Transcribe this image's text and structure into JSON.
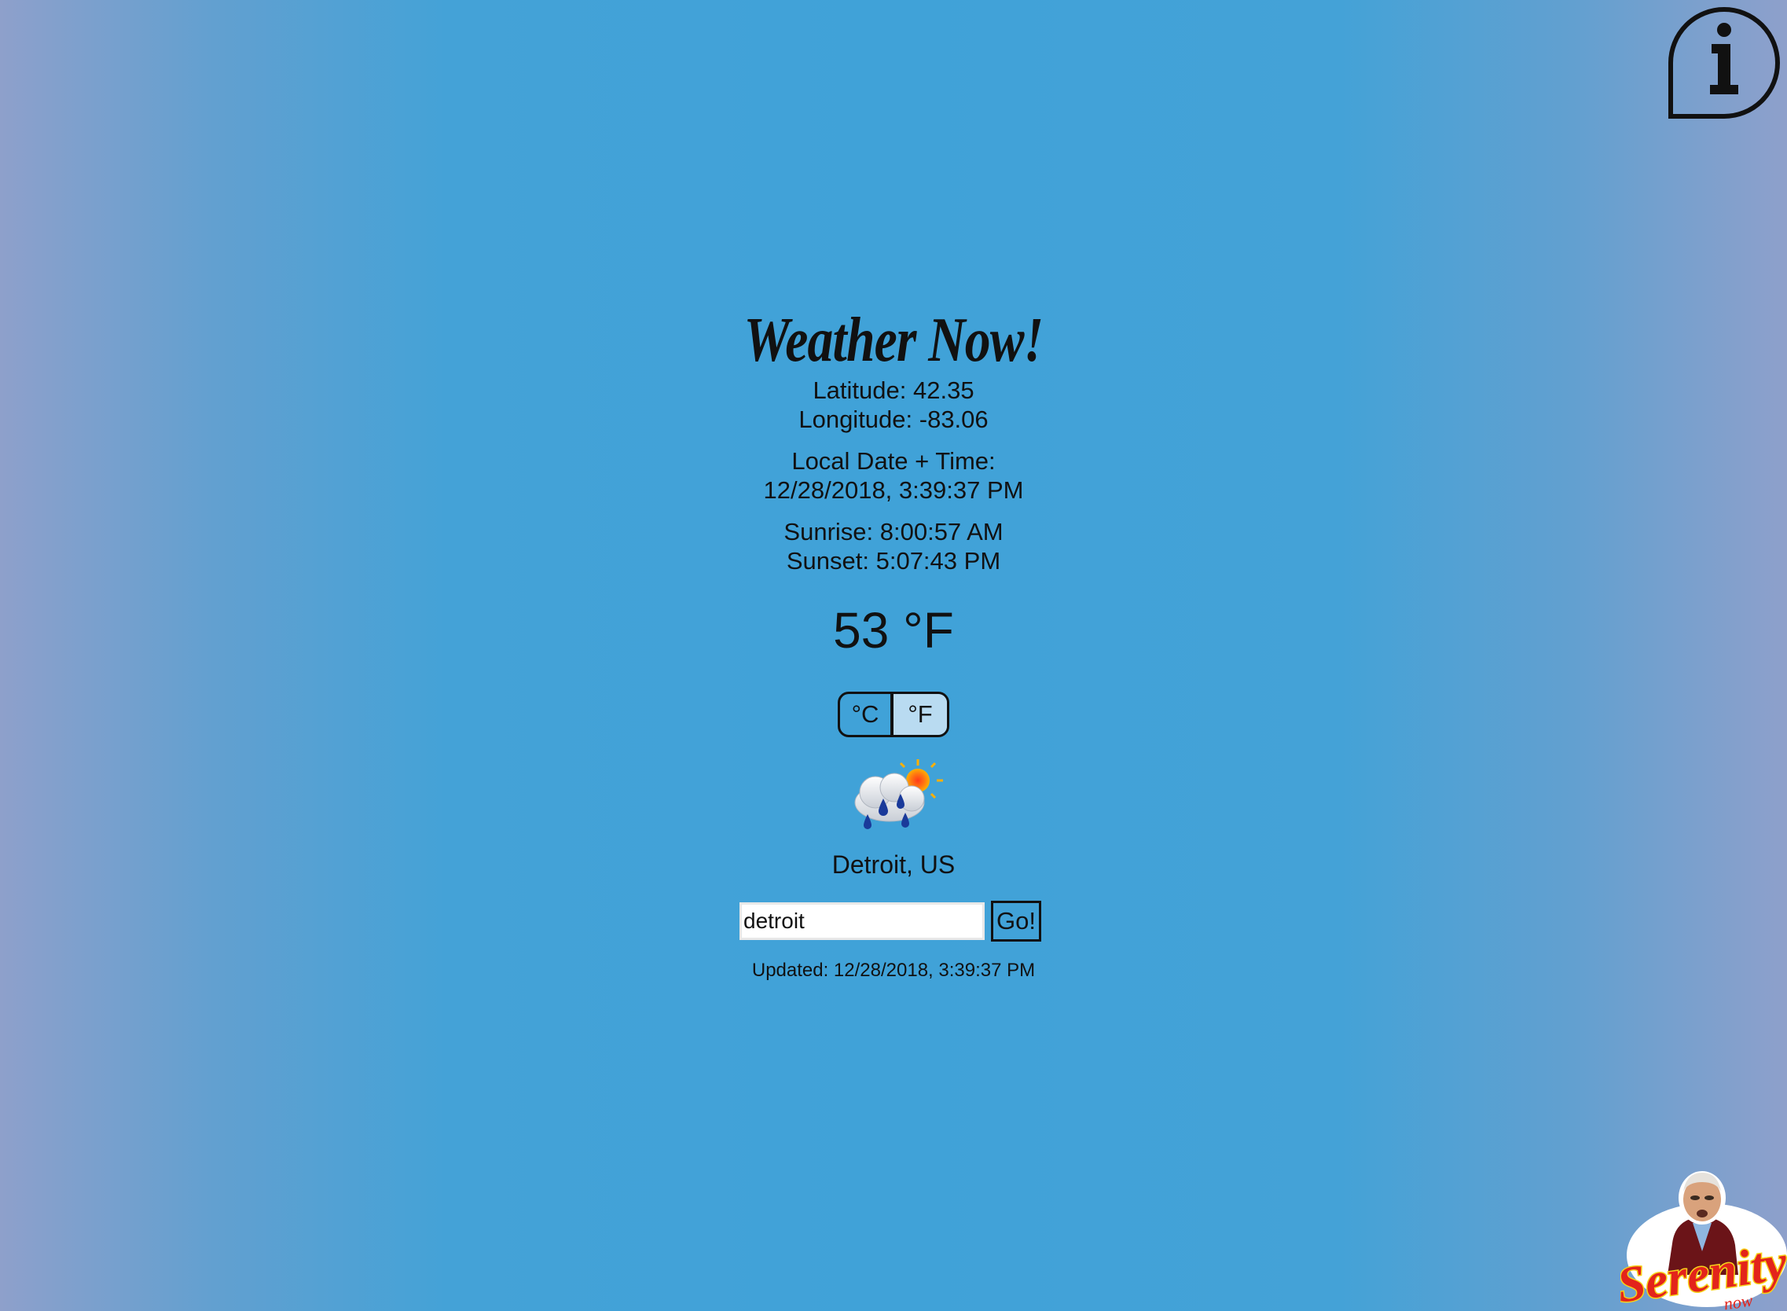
{
  "app": {
    "title": "Weather Now!"
  },
  "coords": {
    "latitude": "Latitude: 42.35",
    "longitude": "Longitude: -83.06"
  },
  "local_time": {
    "label": "Local Date + Time:",
    "value": "12/28/2018, 3:39:37 PM"
  },
  "sun": {
    "sunrise": "Sunrise: 8:00:57 AM",
    "sunset": "Sunset: 5:07:43 PM"
  },
  "temperature": "53 °F",
  "units": {
    "celsius": "°C",
    "fahrenheit": "°F",
    "active": "fahrenheit"
  },
  "condition_icon": "rain-with-sun-icon",
  "location": "Detroit, US",
  "search": {
    "value": "detroit",
    "go_label": "Go!"
  },
  "updated": "Updated: 12/28/2018, 3:39:37 PM",
  "corner_icons": {
    "info": "info-icon",
    "mascot": "serenity-now-logo"
  },
  "logo": {
    "text": "Serenity",
    "subtext": "now"
  },
  "colors": {
    "background_center": "#40a2d8",
    "background_edge": "#8ea0cb",
    "active_unit": "#b9dbf1"
  }
}
